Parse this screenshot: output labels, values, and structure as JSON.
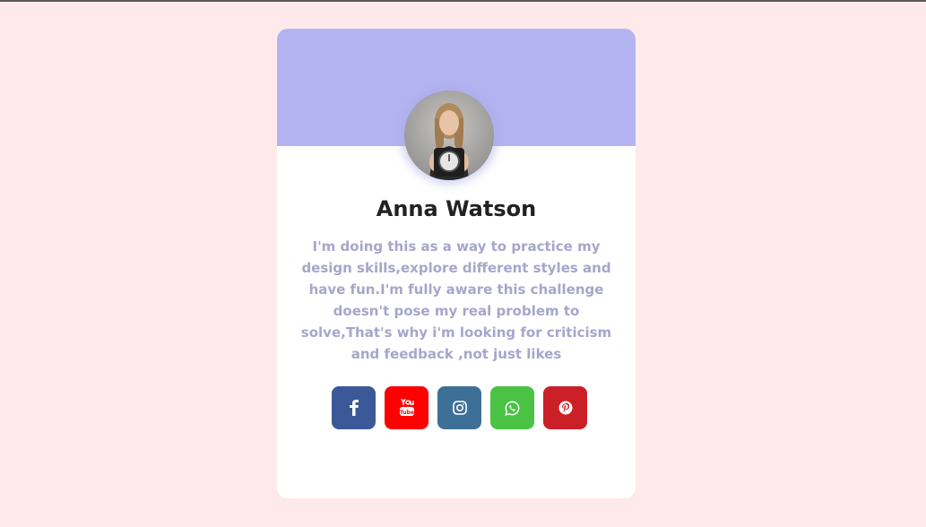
{
  "profile": {
    "name": "Anna Watson",
    "bio": "I'm doing this as a way to practice my design skills,explore different styles and have fun.I'm fully aware this challenge doesn't pose my real problem to solve,That's why i'm looking for criticism and feedback ,not just likes",
    "avatar_icon": "woman-holding-scale-photo"
  },
  "socials": [
    {
      "name": "facebook",
      "icon": "facebook-icon",
      "color": "#3b5998"
    },
    {
      "name": "youtube",
      "icon": "youtube-icon",
      "color": "#ff0000"
    },
    {
      "name": "instagram",
      "icon": "instagram-icon",
      "color": "#3e7097"
    },
    {
      "name": "whatsapp",
      "icon": "whatsapp-icon",
      "color": "#4ac344"
    },
    {
      "name": "pinterest",
      "icon": "pinterest-icon",
      "color": "#cb2027"
    }
  ],
  "colors": {
    "page_background": "#ffe9ea",
    "card_header": "#b4b3f2",
    "card_body": "#ffffff",
    "name_text": "#222222",
    "bio_text": "#a6a6cc"
  }
}
